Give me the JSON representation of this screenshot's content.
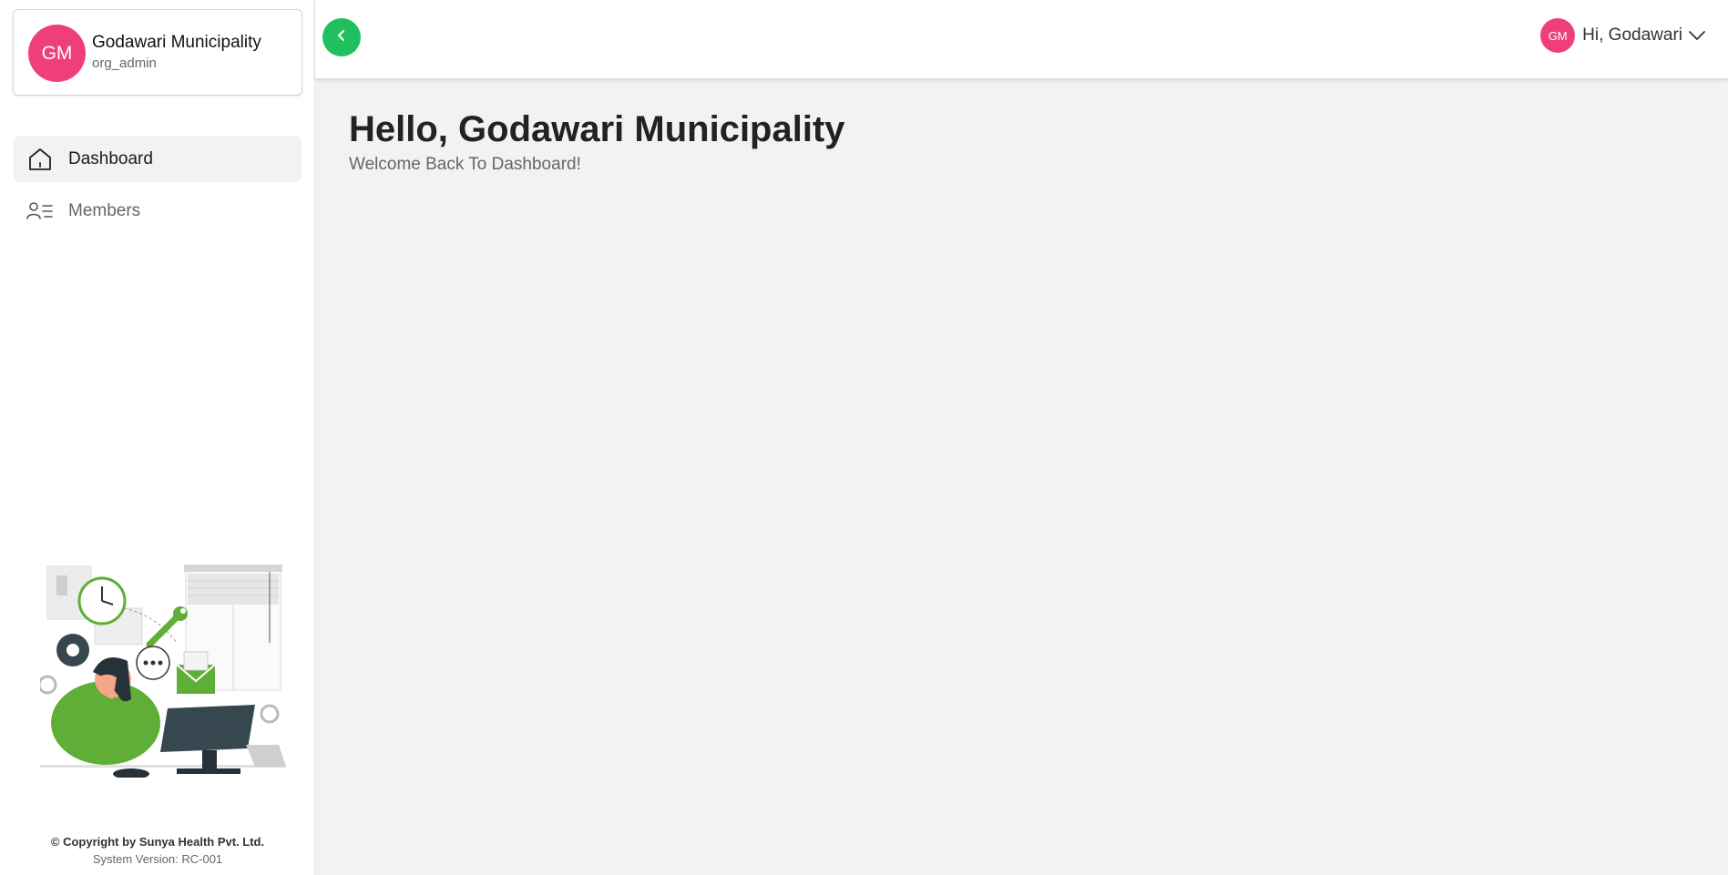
{
  "sidebar": {
    "profile": {
      "initials": "GM",
      "name": "Godawari Municipality",
      "role": "org_admin"
    },
    "items": [
      {
        "label": "Dashboard",
        "icon": "home-icon",
        "active": true
      },
      {
        "label": "Members",
        "icon": "members-list-icon",
        "active": false
      }
    ],
    "copyright": "© Copyright by Sunya Health Pvt. Ltd.",
    "version": "System Version: RC-001"
  },
  "header": {
    "toggle_icon": "chevron-left-icon",
    "user": {
      "initials": "GM",
      "greeting": "Hi, Godawari"
    }
  },
  "main": {
    "title": "Hello, Godawari Municipality",
    "subtitle": "Welcome Back To Dashboard!"
  },
  "colors": {
    "accent_green": "#21c05e",
    "avatar_pink": "#ee3f7c",
    "page_bg": "#f2f2f2"
  }
}
